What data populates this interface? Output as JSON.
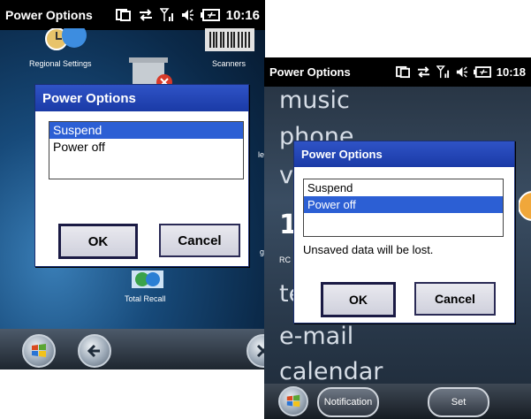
{
  "left_screen": {
    "status": {
      "title": "Power Options",
      "time": "10:16"
    },
    "desktop": {
      "regional_label": "Regional Settings",
      "scanners_label": "Scanners",
      "total_recall_label": "Total Recall",
      "partial_g": "g",
      "partial_le": "le"
    },
    "dialog": {
      "title": "Power Options",
      "options": [
        "Suspend",
        "Power off"
      ],
      "selected": "Suspend",
      "ok_label": "OK",
      "cancel_label": "Cancel"
    }
  },
  "right_screen": {
    "status": {
      "title": "Power Options",
      "time": "10:18"
    },
    "menu": {
      "music": "music",
      "phone": "phone",
      "v_partial": "v",
      "one_partial": "1",
      "rc_partial": "RC",
      "te_partial": "te",
      "email": "e-mail",
      "calendar": "calendar"
    },
    "dialog": {
      "title": "Power Options",
      "options": [
        "Suspend",
        "Power off"
      ],
      "selected": "Power off",
      "warning": "Unsaved data will be lost.",
      "ok_label": "OK",
      "cancel_label": "Cancel"
    },
    "taskbar": {
      "notification_label": "Notification",
      "set_label": "Set"
    }
  },
  "colors": {
    "selection": "#2c5fd4",
    "title_bar": "#1a3aa6",
    "status_bar": "#000000"
  }
}
